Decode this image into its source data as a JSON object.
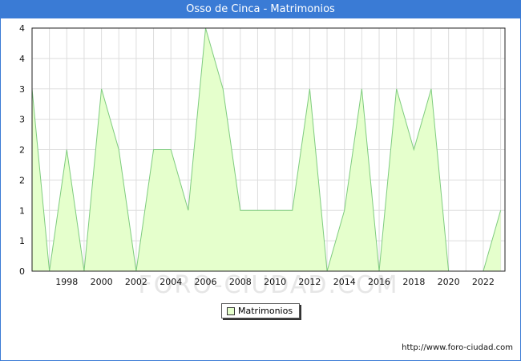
{
  "title": "Osso de Cinca - Matrimonios",
  "watermark": "FORO-CIUDAD.COM",
  "source_url": "http://www.foro-ciudad.com",
  "colors": {
    "title_bar": "#3a7bd5",
    "area_fill": "#e5ffcc",
    "line": "#7fcc7f",
    "grid": "#dddddd"
  },
  "chart_data": {
    "type": "area",
    "title": "Osso de Cinca - Matrimonios",
    "xlabel": "",
    "ylabel": "",
    "x": [
      1996,
      1997,
      1998,
      1999,
      2000,
      2001,
      2002,
      2003,
      2004,
      2005,
      2006,
      2007,
      2008,
      2009,
      2010,
      2011,
      2012,
      2013,
      2014,
      2015,
      2016,
      2017,
      2018,
      2019,
      2020,
      2021,
      2022,
      2023
    ],
    "series": [
      {
        "name": "Matrimonios",
        "values": [
          3,
          0,
          2,
          0,
          3,
          2,
          0,
          2,
          2,
          1,
          4,
          3,
          1,
          1,
          1,
          1,
          3,
          0,
          1,
          3,
          0,
          3,
          2,
          3,
          0,
          0,
          0,
          1
        ]
      }
    ],
    "ylim": [
      0,
      4
    ],
    "y_ticks": [
      0,
      0.5,
      1,
      1.5,
      2,
      2.5,
      3,
      3.5,
      4
    ],
    "y_tick_labels": [
      "0",
      "1",
      "1",
      "2",
      "2",
      "3",
      "3",
      "4",
      "4"
    ],
    "x_ticks": [
      1998,
      2000,
      2002,
      2004,
      2006,
      2008,
      2010,
      2012,
      2014,
      2016,
      2018,
      2020,
      2022
    ],
    "grid": true,
    "legend": "bottom-center"
  }
}
